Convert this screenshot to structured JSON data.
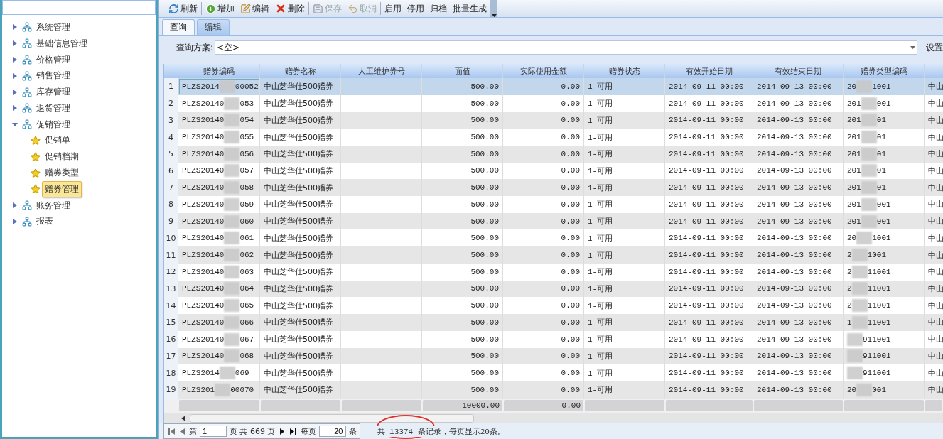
{
  "sidebar": {
    "tree": [
      {
        "label": "系统管理",
        "expanded": false
      },
      {
        "label": "基础信息管理",
        "expanded": false
      },
      {
        "label": "价格管理",
        "expanded": false
      },
      {
        "label": "销售管理",
        "expanded": false
      },
      {
        "label": "库存管理",
        "expanded": false
      },
      {
        "label": "退货管理",
        "expanded": false
      },
      {
        "label": "促销管理",
        "expanded": true,
        "children": [
          {
            "label": "促销单",
            "selected": false
          },
          {
            "label": "促销档期",
            "selected": false
          },
          {
            "label": "赠券类型",
            "selected": false
          },
          {
            "label": "赠券管理",
            "selected": true
          }
        ]
      },
      {
        "label": "账务管理",
        "expanded": false
      },
      {
        "label": "报表",
        "expanded": false
      }
    ]
  },
  "toolbar": [
    {
      "label": "刷新",
      "kind": "refresh",
      "disabled": false
    },
    {
      "label": "增加",
      "kind": "add",
      "disabled": false
    },
    {
      "label": "编辑",
      "kind": "edit",
      "disabled": false
    },
    {
      "label": "删除",
      "kind": "delete",
      "disabled": false
    },
    {
      "label": "保存",
      "kind": "save",
      "disabled": true
    },
    {
      "label": "取消",
      "kind": "cancel",
      "disabled": true
    },
    {
      "label": "启用",
      "kind": "text",
      "disabled": false
    },
    {
      "label": "停用",
      "kind": "text",
      "disabled": false
    },
    {
      "label": "归档",
      "kind": "text",
      "disabled": false
    },
    {
      "label": "批量生成",
      "kind": "text",
      "disabled": false
    }
  ],
  "tabs": [
    {
      "label": "查询",
      "selected": false
    },
    {
      "label": "编辑",
      "selected": true
    }
  ],
  "query": {
    "label": "查询方案:",
    "value": "<空>",
    "settings": "设置"
  },
  "table": {
    "columns": [
      "赠券编码",
      "赠券名称",
      "人工维护券号",
      "面值",
      "实际使用金额",
      "赠券状态",
      "有效开始日期",
      "有效结束日期",
      "赠券类型编码"
    ],
    "rows": [
      {
        "num": "1",
        "code_start": "PLZS2014",
        "code_end": "00052",
        "name": "中山芝华仕500赠券",
        "face": "500.00",
        "actual": "0.00",
        "status": "1-可用",
        "start": "2014-09-11 00:00",
        "end": "2014-09-13 00:00",
        "type_start": "20",
        "type_end": "1001",
        "column_11": "中山",
        "selected": true
      },
      {
        "num": "2",
        "code_start": "PLZS20140",
        "code_end": "053",
        "name": "中山芝华仕500赠券",
        "face": "500.00",
        "actual": "0.00",
        "status": "1-可用",
        "start": "2014-09-11 00:00",
        "end": "2014-09-13 00:00",
        "type_start": "201",
        "type_end": "001",
        "column_11": "中山",
        "selected": false
      },
      {
        "num": "3",
        "code_start": "PLZS20140",
        "code_end": "054",
        "name": "中山芝华仕500赠券",
        "face": "500.00",
        "actual": "0.00",
        "status": "1-可用",
        "start": "2014-09-11 00:00",
        "end": "2014-09-13 00:00",
        "type_start": "201",
        "type_end": "01",
        "column_11": "中山",
        "selected": false
      },
      {
        "num": "4",
        "code_start": "PLZS20140",
        "code_end": "055",
        "name": "中山芝华仕500赠券",
        "face": "500.00",
        "actual": "0.00",
        "status": "1-可用",
        "start": "2014-09-11 00:00",
        "end": "2014-09-13 00:00",
        "type_start": "201",
        "type_end": "01",
        "column_11": "中山",
        "selected": false
      },
      {
        "num": "5",
        "code_start": "PLZS20140",
        "code_end": "056",
        "name": "中山芝华仕500赠券",
        "face": "500.00",
        "actual": "0.00",
        "status": "1-可用",
        "start": "2014-09-11 00:00",
        "end": "2014-09-13 00:00",
        "type_start": "201",
        "type_end": "01",
        "column_11": "中山",
        "selected": false
      },
      {
        "num": "6",
        "code_start": "PLZS20140",
        "code_end": "057",
        "name": "中山芝华仕500赠券",
        "face": "500.00",
        "actual": "0.00",
        "status": "1-可用",
        "start": "2014-09-11 00:00",
        "end": "2014-09-13 00:00",
        "type_start": "201",
        "type_end": "01",
        "column_11": "中山",
        "selected": false
      },
      {
        "num": "7",
        "code_start": "PLZS20140",
        "code_end": "058",
        "name": "中山芝华仕500赠券",
        "face": "500.00",
        "actual": "0.00",
        "status": "1-可用",
        "start": "2014-09-11 00:00",
        "end": "2014-09-13 00:00",
        "type_start": "201",
        "type_end": "01",
        "column_11": "中山",
        "selected": false
      },
      {
        "num": "8",
        "code_start": "PLZS20140",
        "code_end": "059",
        "name": "中山芝华仕500赠券",
        "face": "500.00",
        "actual": "0.00",
        "status": "1-可用",
        "start": "2014-09-11 00:00",
        "end": "2014-09-13 00:00",
        "type_start": "201",
        "type_end": "001",
        "column_11": "中山",
        "selected": false
      },
      {
        "num": "9",
        "code_start": "PLZS20140",
        "code_end": "060",
        "name": "中山芝华仕500赠券",
        "face": "500.00",
        "actual": "0.00",
        "status": "1-可用",
        "start": "2014-09-11 00:00",
        "end": "2014-09-13 00:00",
        "type_start": "201",
        "type_end": "001",
        "column_11": "中山",
        "selected": false
      },
      {
        "num": "10",
        "code_start": "PLZS20140",
        "code_end": "061",
        "name": "中山芝华仕500赠券",
        "face": "500.00",
        "actual": "0.00",
        "status": "1-可用",
        "start": "2014-09-11 00:00",
        "end": "2014-09-13 00:00",
        "type_start": "20",
        "type_end": "1001",
        "column_11": "中山",
        "selected": false
      },
      {
        "num": "11",
        "code_start": "PLZS20140",
        "code_end": "062",
        "name": "中山芝华仕500赠券",
        "face": "500.00",
        "actual": "0.00",
        "status": "1-可用",
        "start": "2014-09-11 00:00",
        "end": "2014-09-13 00:00",
        "type_start": "2",
        "type_end": "1001",
        "column_11": "中山",
        "selected": false
      },
      {
        "num": "12",
        "code_start": "PLZS20140",
        "code_end": "063",
        "name": "中山芝华仕500赠券",
        "face": "500.00",
        "actual": "0.00",
        "status": "1-可用",
        "start": "2014-09-11 00:00",
        "end": "2014-09-13 00:00",
        "type_start": "2",
        "type_end": "11001",
        "column_11": "中山",
        "selected": false
      },
      {
        "num": "13",
        "code_start": "PLZS20140",
        "code_end": "064",
        "name": "中山芝华仕500赠券",
        "face": "500.00",
        "actual": "0.00",
        "status": "1-可用",
        "start": "2014-09-11 00:00",
        "end": "2014-09-13 00:00",
        "type_start": "2",
        "type_end": "11001",
        "column_11": "中山",
        "selected": false
      },
      {
        "num": "14",
        "code_start": "PLZS20140",
        "code_end": "065",
        "name": "中山芝华仕500赠券",
        "face": "500.00",
        "actual": "0.00",
        "status": "1-可用",
        "start": "2014-09-11 00:00",
        "end": "2014-09-13 00:00",
        "type_start": "2",
        "type_end": "11001",
        "column_11": "中山",
        "selected": false
      },
      {
        "num": "15",
        "code_start": "PLZS20140",
        "code_end": "066",
        "name": "中山芝华仕500赠券",
        "face": "500.00",
        "actual": "0.00",
        "status": "1-可用",
        "start": "2014-09-11 00:00",
        "end": "2014-09-13 00:00",
        "type_start": "1",
        "type_end": "11001",
        "column_11": "中山",
        "selected": false
      },
      {
        "num": "16",
        "code_start": "PLZS20140",
        "code_end": "067",
        "name": "中山芝华仕500赠券",
        "face": "500.00",
        "actual": "0.00",
        "status": "1-可用",
        "start": "2014-09-11 00:00",
        "end": "2014-09-13 00:00",
        "type_end": "911001",
        "column_11": "中山",
        "selected": false
      },
      {
        "num": "17",
        "code_start": "PLZS20140",
        "code_end": "068",
        "name": "中山芝华仕500赠券",
        "face": "500.00",
        "actual": "0.00",
        "status": "1-可用",
        "start": "2014-09-11 00:00",
        "end": "2014-09-13 00:00",
        "type_end": "911001",
        "column_11": "中山",
        "selected": false
      },
      {
        "num": "18",
        "code_start": "PLZS2014",
        "code_end": "069",
        "name": "中山芝华仕500赠券",
        "face": "500.00",
        "actual": "0.00",
        "status": "1-可用",
        "start": "2014-09-11 00:00",
        "end": "2014-09-13 00:00",
        "type_end": "911001",
        "column_11": "中山",
        "selected": false
      },
      {
        "num": "19",
        "code_start": "PLZS201",
        "code_end": "00070",
        "name": "中山芝华仕500赠券",
        "face": "500.00",
        "actual": "0.00",
        "status": "1-可用",
        "start": "2014-09-11 00:00",
        "end": "2014-09-13 00:00",
        "type_start": "20",
        "type_end": "001",
        "column_11": "中山",
        "selected": false
      }
    ],
    "summary": {
      "face": "10000.00",
      "actual": "0.00"
    }
  },
  "pager": {
    "page_prefix": "第",
    "page": "1",
    "page_suffix": "页 共 669 页",
    "per_page_label": "每页",
    "per_page": "20",
    "per_page_unit": "条",
    "info": "共 13374 条记录，每页显示20条。"
  }
}
